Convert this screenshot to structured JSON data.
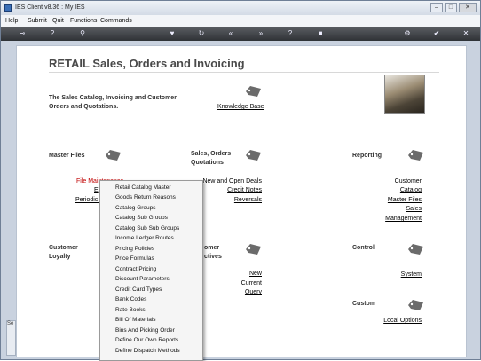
{
  "window": {
    "title": "IES Client v8.36 : My IES"
  },
  "menu": [
    "Help",
    "Submit",
    "Quit",
    "Functions",
    "Commands"
  ],
  "colors": {
    "toolbar": "#3b3e42",
    "frame": "#c9d2df",
    "accent_link": "#c00000"
  },
  "page": {
    "title": "RETAIL Sales, Orders and Invoicing",
    "intro": "The Sales Catalog, Invoicing and Customer Orders and Quotations.",
    "knowledge_base": "Knowledge Base"
  },
  "sections": {
    "master_files": {
      "heading": "Master Files",
      "file_maintenance": "File Maintenance",
      "e_partial": "E",
      "periodic_partial": "Periodic U"
    },
    "sales_orders": {
      "heading": "Sales, Orders Quotations",
      "links": [
        "New and Open Deals",
        "Credit Notes",
        "Reversals"
      ]
    },
    "reporting": {
      "heading": "Reporting",
      "links": [
        "Customer",
        "Catalog",
        "Master Files",
        "Sales",
        "Management"
      ]
    },
    "customer_loyalty": {
      "heading": "Customer Loyalty"
    },
    "customer_actives": {
      "heading_line1": "omer",
      "heading_line2": "ctives",
      "links": [
        "New",
        "Current",
        "Query"
      ]
    },
    "control": {
      "heading": "Control",
      "links": [
        "System"
      ]
    },
    "custom": {
      "heading": "Custom",
      "links": [
        "Local Options"
      ]
    }
  },
  "dropdown_items": [
    "Retail Catalog Master",
    "Goods Return Reasons",
    "Catalog Groups",
    "Catalog Sub Groups",
    "Catalog Sub Sub Groups",
    "Income Ledger Routes",
    "Pricing Policies",
    "Price Formulas",
    "Contract Pricing",
    "Discount Parameters",
    "Credit Card Types",
    "Bank Codes",
    "Rate Books",
    "Bill Of Materials",
    "Bins And Picking Order",
    "Define Our Own Reports",
    "Define Dispatch Methods"
  ],
  "left_strip": {
    "label": "Se"
  }
}
